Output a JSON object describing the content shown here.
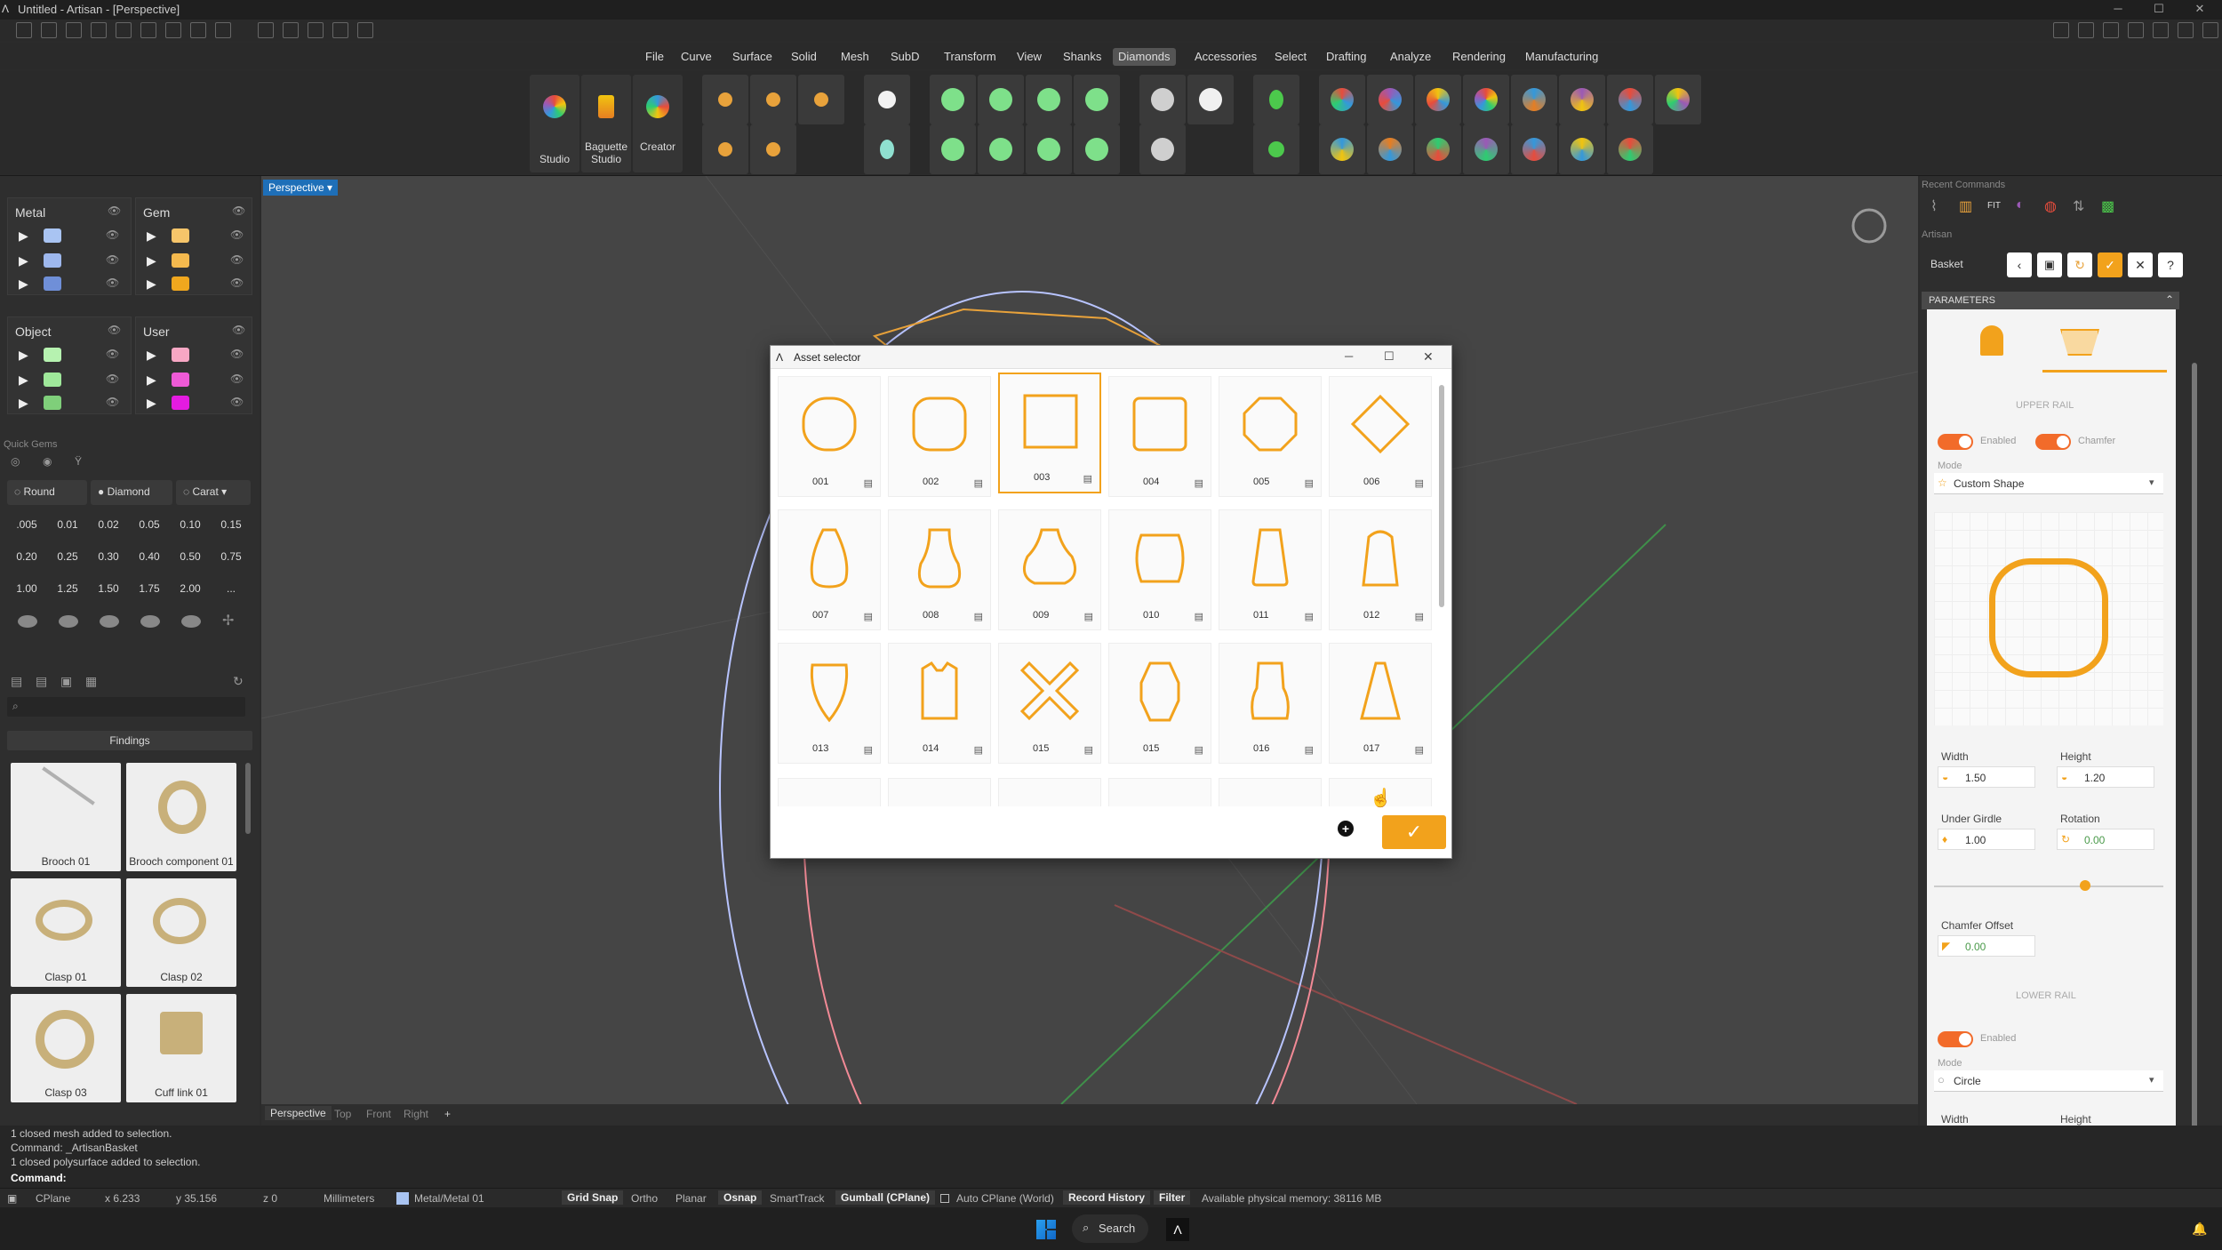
{
  "window": {
    "title": "Untitled - Artisan - [Perspective]"
  },
  "menu": [
    "File",
    "Curve",
    "Surface",
    "Solid",
    "Mesh",
    "SubD",
    "Transform",
    "View",
    "Shanks",
    "Diamonds",
    "Accessories",
    "Select",
    "Drafting",
    "Analyze",
    "Rendering",
    "Manufacturing"
  ],
  "menu_active": "Diamonds",
  "ribbon": {
    "studio": "Studio",
    "baguette_line1": "Baguette",
    "baguette_line2": "Studio",
    "creator": "Creator"
  },
  "layers": {
    "metal": "Metal",
    "gem": "Gem",
    "object": "Object",
    "user": "User",
    "metal_colors": [
      "#a9c4f2",
      "#9eb8ee",
      "#6f8fd8"
    ],
    "gem_colors": [
      "#f6c56a",
      "#f4b94e",
      "#f0a71e"
    ],
    "object_colors": [
      "#b6f2b0",
      "#9fe89a",
      "#7fcf7a"
    ],
    "user_colors": [
      "#f7a7c4",
      "#ee5ad6",
      "#e41be1"
    ]
  },
  "quick_gems": {
    "title": "Quick Gems",
    "round": "Round",
    "diamond": "Diamond",
    "carat": "Carat",
    "carats": [
      ".005",
      "0.01",
      "0.02",
      "0.05",
      "0.10",
      "0.15",
      "0.20",
      "0.25",
      "0.30",
      "0.40",
      "0.50",
      "0.75",
      "1.00",
      "1.25",
      "1.50",
      "1.75",
      "2.00",
      "..."
    ]
  },
  "library": {
    "category": "Findings",
    "items": [
      {
        "label": "Brooch 01"
      },
      {
        "label": "Brooch component 01"
      },
      {
        "label": "Clasp 01"
      },
      {
        "label": "Clasp 02"
      },
      {
        "label": "Clasp 03"
      },
      {
        "label": "Cuff link 01"
      }
    ]
  },
  "viewport": {
    "tab": "Perspective",
    "bottom_tabs": [
      "Perspective",
      "Top",
      "Front",
      "Right"
    ]
  },
  "dialog": {
    "title": "Asset selector",
    "tiles": [
      "001",
      "002",
      "003",
      "004",
      "005",
      "006",
      "007",
      "008",
      "009",
      "010",
      "011",
      "012",
      "013",
      "014",
      "015",
      "015",
      "016",
      "017"
    ],
    "selected": "003"
  },
  "right_panel": {
    "recent": "Recent Commands",
    "fit": "FIT",
    "artisan": "Artisan",
    "basket": "Basket",
    "parameters": "PARAMETERS",
    "upper_rail": "UPPER RAIL",
    "enabled": "Enabled",
    "chamfer": "Chamfer",
    "mode": "Mode",
    "mode_value": "Custom Shape",
    "width": "Width",
    "width_value": "1.50",
    "height": "Height",
    "height_value": "1.20",
    "under_girdle": "Under Girdle",
    "under_girdle_value": "1.00",
    "rotation": "Rotation",
    "rotation_value": "0.00",
    "chamfer_offset": "Chamfer Offset",
    "chamfer_offset_value": "0.00",
    "lower_rail": "LOWER RAIL",
    "lower_enabled": "Enabled",
    "lower_mode": "Mode",
    "lower_mode_value": "Circle",
    "lower_width": "Width",
    "lower_height": "Height",
    "accent": "#f2a21c"
  },
  "command": {
    "lines": [
      "1 closed mesh added to selection.",
      "Command: _ArtisanBasket",
      "1 closed polysurface added to selection."
    ],
    "prompt": "Command:"
  },
  "status": {
    "cplane": "CPlane",
    "x": "x 6.233",
    "y": "y 35.156",
    "z": "z 0",
    "units": "Millimeters",
    "layer": "Metal/Metal 01",
    "grid_snap": "Grid Snap",
    "ortho": "Ortho",
    "planar": "Planar",
    "osnap": "Osnap",
    "smarttrack": "SmartTrack",
    "gumball": "Gumball (CPlane)",
    "autocplane": "Auto CPlane (World)",
    "record": "Record History",
    "filter": "Filter",
    "memory": "Available physical memory: 38116 MB"
  },
  "taskbar": {
    "search": "Search"
  }
}
